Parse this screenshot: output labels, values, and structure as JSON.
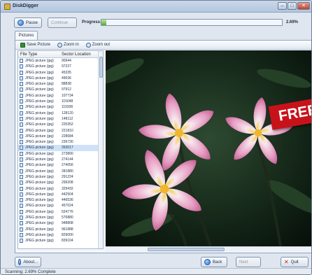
{
  "window": {
    "title": "DiskDigger"
  },
  "toolbar": {
    "pause_label": "Pause",
    "continue_label": "Continue",
    "progress_label": "Progress:",
    "progress_value": 0.0269,
    "progress_text": "2.69%"
  },
  "tabs": [
    {
      "label": "Pictures"
    }
  ],
  "panel_toolbar": {
    "save_label": "Save Picture",
    "zoom_in_label": "Zoom in",
    "zoom_out_label": "Zoom out"
  },
  "list": {
    "columns": [
      "File Type",
      "Sector Location"
    ],
    "rows": [
      {
        "type": "JPEG picture (jpg)",
        "sector": "90944"
      },
      {
        "type": "JPEG picture (jpg)",
        "sector": "97227"
      },
      {
        "type": "JPEG picture (jpg)",
        "sector": "45335"
      },
      {
        "type": "JPEG picture (jpg)",
        "sector": "49036"
      },
      {
        "type": "JPEG picture (jpg)",
        "sector": "88838"
      },
      {
        "type": "JPEG picture (jpg)",
        "sector": "97912"
      },
      {
        "type": "JPEG picture (jpg)",
        "sector": "107734"
      },
      {
        "type": "JPEG picture (jpg)",
        "sector": "115048"
      },
      {
        "type": "JPEG picture (jpg)",
        "sector": "115936"
      },
      {
        "type": "JPEG picture (jpg)",
        "sector": "128120"
      },
      {
        "type": "JPEG picture (jpg)",
        "sector": "148112"
      },
      {
        "type": "JPEG picture (jpg)",
        "sector": "220352"
      },
      {
        "type": "JPEG picture (jpg)",
        "sector": "221810"
      },
      {
        "type": "JPEG picture (jpg)",
        "sector": "228684"
      },
      {
        "type": "JPEG picture (jpg)",
        "sector": "236730"
      },
      {
        "type": "JPEG picture (jpg)",
        "sector": "263017"
      },
      {
        "type": "JPEG picture (jpg)",
        "sector": "273800"
      },
      {
        "type": "JPEG picture (jpg)",
        "sector": "274144"
      },
      {
        "type": "JPEG picture (jpg)",
        "sector": "274056"
      },
      {
        "type": "JPEG picture (jpg)",
        "sector": "281880"
      },
      {
        "type": "JPEG picture (jpg)",
        "sector": "291224"
      },
      {
        "type": "JPEG picture (jpg)",
        "sector": "299208"
      },
      {
        "type": "JPEG picture (jpg)",
        "sector": "329432"
      },
      {
        "type": "JPEG picture (jpg)",
        "sector": "442504"
      },
      {
        "type": "JPEG picture (jpg)",
        "sector": "446536"
      },
      {
        "type": "JPEG picture (jpg)",
        "sector": "457024"
      },
      {
        "type": "JPEG picture (jpg)",
        "sector": "524776"
      },
      {
        "type": "JPEG picture (jpg)",
        "sector": "576880"
      },
      {
        "type": "JPEG picture (jpg)",
        "sector": "948808"
      },
      {
        "type": "JPEG picture (jpg)",
        "sector": "961888"
      },
      {
        "type": "JPEG picture (jpg)",
        "sector": "829000"
      },
      {
        "type": "JPEG picture (jpg)",
        "sector": "839104"
      }
    ],
    "selected_row": 15
  },
  "preview": {
    "banner_text": "FREE"
  },
  "footer": {
    "about_label": "About...",
    "back_label": "Back",
    "next_label": "Next",
    "quit_label": "Quit"
  },
  "status": {
    "text": "Scanning: 2.69% Complete"
  },
  "colors": {
    "accent": "#2c6bc4",
    "progress": "#55aa2f",
    "banner": "#c8121a"
  }
}
